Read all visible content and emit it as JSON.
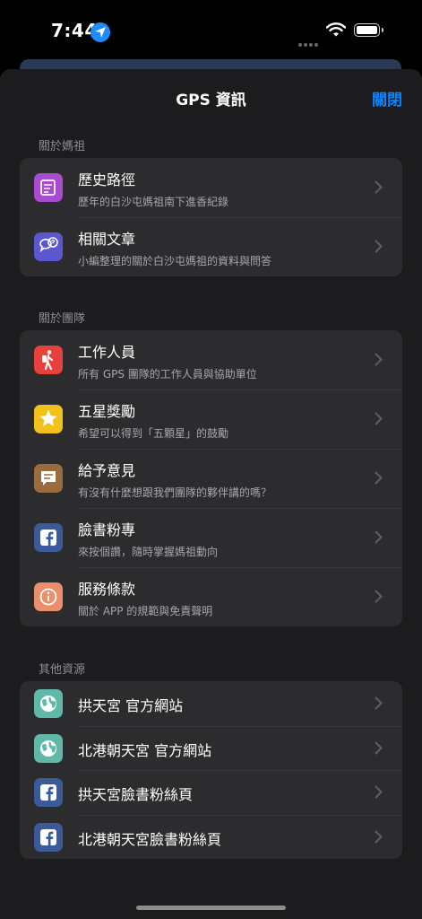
{
  "status_bar": {
    "time": "7:44"
  },
  "nav": {
    "title": "GPS 資訊",
    "close_label": "關閉"
  },
  "sections": [
    {
      "header": "關於媽祖",
      "items": [
        {
          "title": "歷史路徑",
          "subtitle": "歷年的白沙屯媽祖南下進香紀錄",
          "icon": "scroll-icon",
          "color": "#a94bd0"
        },
        {
          "title": "相關文章",
          "subtitle": "小編整理的關於白沙屯媽祖的資料與問答",
          "icon": "question-bubble-icon",
          "color": "#5a57cf"
        }
      ]
    },
    {
      "header": "關於團隊",
      "items": [
        {
          "title": "工作人員",
          "subtitle": "所有 GPS 團隊的工作人員與協助單位",
          "icon": "hiker-icon",
          "color": "#e8413c"
        },
        {
          "title": "五星獎勵",
          "subtitle": "希望可以得到「五顆星」的鼓勵",
          "icon": "star-icon",
          "color": "#f1c21b"
        },
        {
          "title": "給予意見",
          "subtitle": "有沒有什麼想跟我們團隊的夥伴講的嗎？",
          "icon": "message-icon",
          "color": "#9a6b3c"
        },
        {
          "title": "臉書粉專",
          "subtitle": "來按個讚，隨時掌握媽祖動向",
          "icon": "facebook-icon",
          "color": "#3b5a9a"
        },
        {
          "title": "服務條款",
          "subtitle": "關於 APP 的規範與免責聲明",
          "icon": "info-icon",
          "color": "#ea8e6c"
        }
      ]
    },
    {
      "header": "其他資源",
      "items": [
        {
          "title": "拱天宮 官方網站",
          "icon": "globe-icon",
          "color": "#5fb8a8"
        },
        {
          "title": "北港朝天宮 官方網站",
          "icon": "globe-icon",
          "color": "#5fb8a8"
        },
        {
          "title": "拱天宮臉書粉絲頁",
          "icon": "facebook-icon",
          "color": "#3b5a9a"
        },
        {
          "title": "北港朝天宮臉書粉絲頁",
          "icon": "facebook-icon",
          "color": "#3b5a9a"
        }
      ]
    }
  ]
}
